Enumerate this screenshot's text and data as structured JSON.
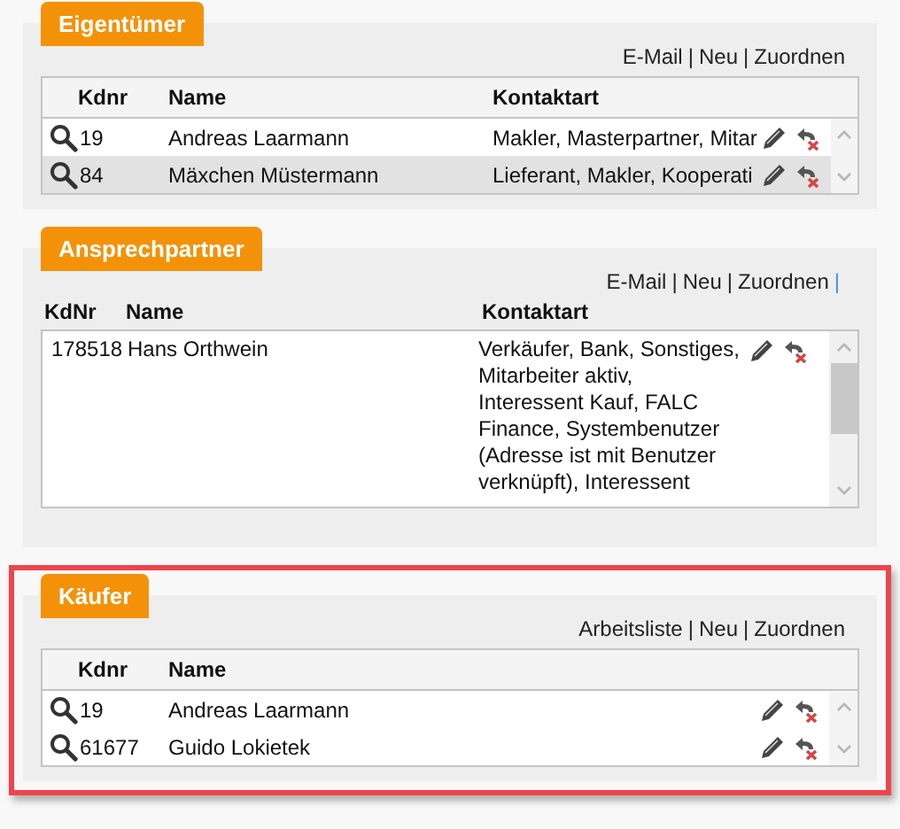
{
  "panels": [
    {
      "kind": "table",
      "title": "Eigentümer",
      "links": [
        "E-Mail",
        "Neu",
        "Zuordnen"
      ],
      "separator": "|",
      "trailing_separator": false,
      "highlighted": false,
      "columns": [
        "Kdnr",
        "Name",
        "Kontaktart"
      ],
      "rows": [
        {
          "kdnr": "19",
          "name": "Andreas Laarmann",
          "kontaktart": "Makler, Masterpartner, Mitar",
          "selected": false
        },
        {
          "kdnr": "84",
          "name": "Mäxchen Müstermann",
          "kontaktart": "Lieferant, Makler, Kooperati",
          "selected": true
        }
      ]
    },
    {
      "kind": "contacts",
      "title": "Ansprechpartner",
      "links": [
        "E-Mail",
        "Neu",
        "Zuordnen"
      ],
      "separator": "|",
      "trailing_separator": true,
      "highlighted": false,
      "columns": [
        "KdNr",
        "Name",
        "Kontaktart"
      ],
      "rows": [
        {
          "kdnr": "178518",
          "name": "Hans Orthwein",
          "kontaktart": "Verkäufer, Bank, Sonstiges,\nMitarbeiter aktiv,\nInteressent Kauf, FALC\nFinance, Systembenutzer\n(Adresse ist mit Benutzer\nverknüpft), Interessent",
          "selected": false
        }
      ]
    },
    {
      "kind": "table",
      "title": "Käufer",
      "links": [
        "Arbeitsliste",
        "Neu",
        "Zuordnen"
      ],
      "separator": "|",
      "trailing_separator": false,
      "highlighted": true,
      "columns": [
        "Kdnr",
        "Name"
      ],
      "rows": [
        {
          "kdnr": "19",
          "name": "Andreas Laarmann",
          "selected": false
        },
        {
          "kdnr": "61677",
          "name": "Guido Lokietek",
          "selected": false
        }
      ]
    }
  ]
}
